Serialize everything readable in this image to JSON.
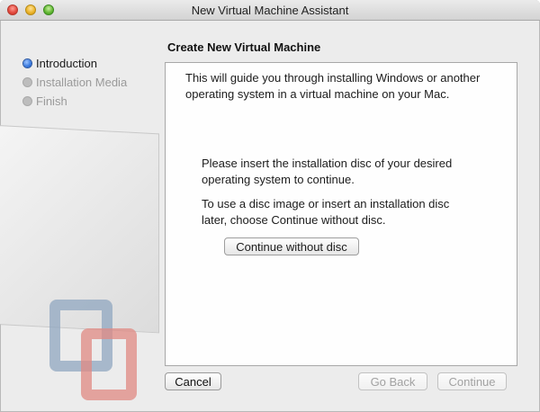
{
  "window": {
    "title": "New Virtual Machine Assistant"
  },
  "sidebar": {
    "steps": [
      {
        "label": "Introduction",
        "state": "active"
      },
      {
        "label": "Installation Media",
        "state": "inactive"
      },
      {
        "label": "Finish",
        "state": "inactive"
      }
    ]
  },
  "main": {
    "heading": "Create New Virtual Machine",
    "intro_text": "This will guide you through installing Windows or another operating system in a virtual machine on your Mac.",
    "insert_text": "Please insert the installation disc of your desired operating system to continue.",
    "later_text": "To use a disc image or insert an installation disc later, choose Continue without disc.",
    "continue_without_disc_label": "Continue without disc"
  },
  "footer": {
    "cancel_label": "Cancel",
    "go_back_label": "Go Back",
    "continue_label": "Continue"
  },
  "colors": {
    "accent_blue": "#2c6fd9",
    "inactive_gray": "#9a9a9a"
  }
}
